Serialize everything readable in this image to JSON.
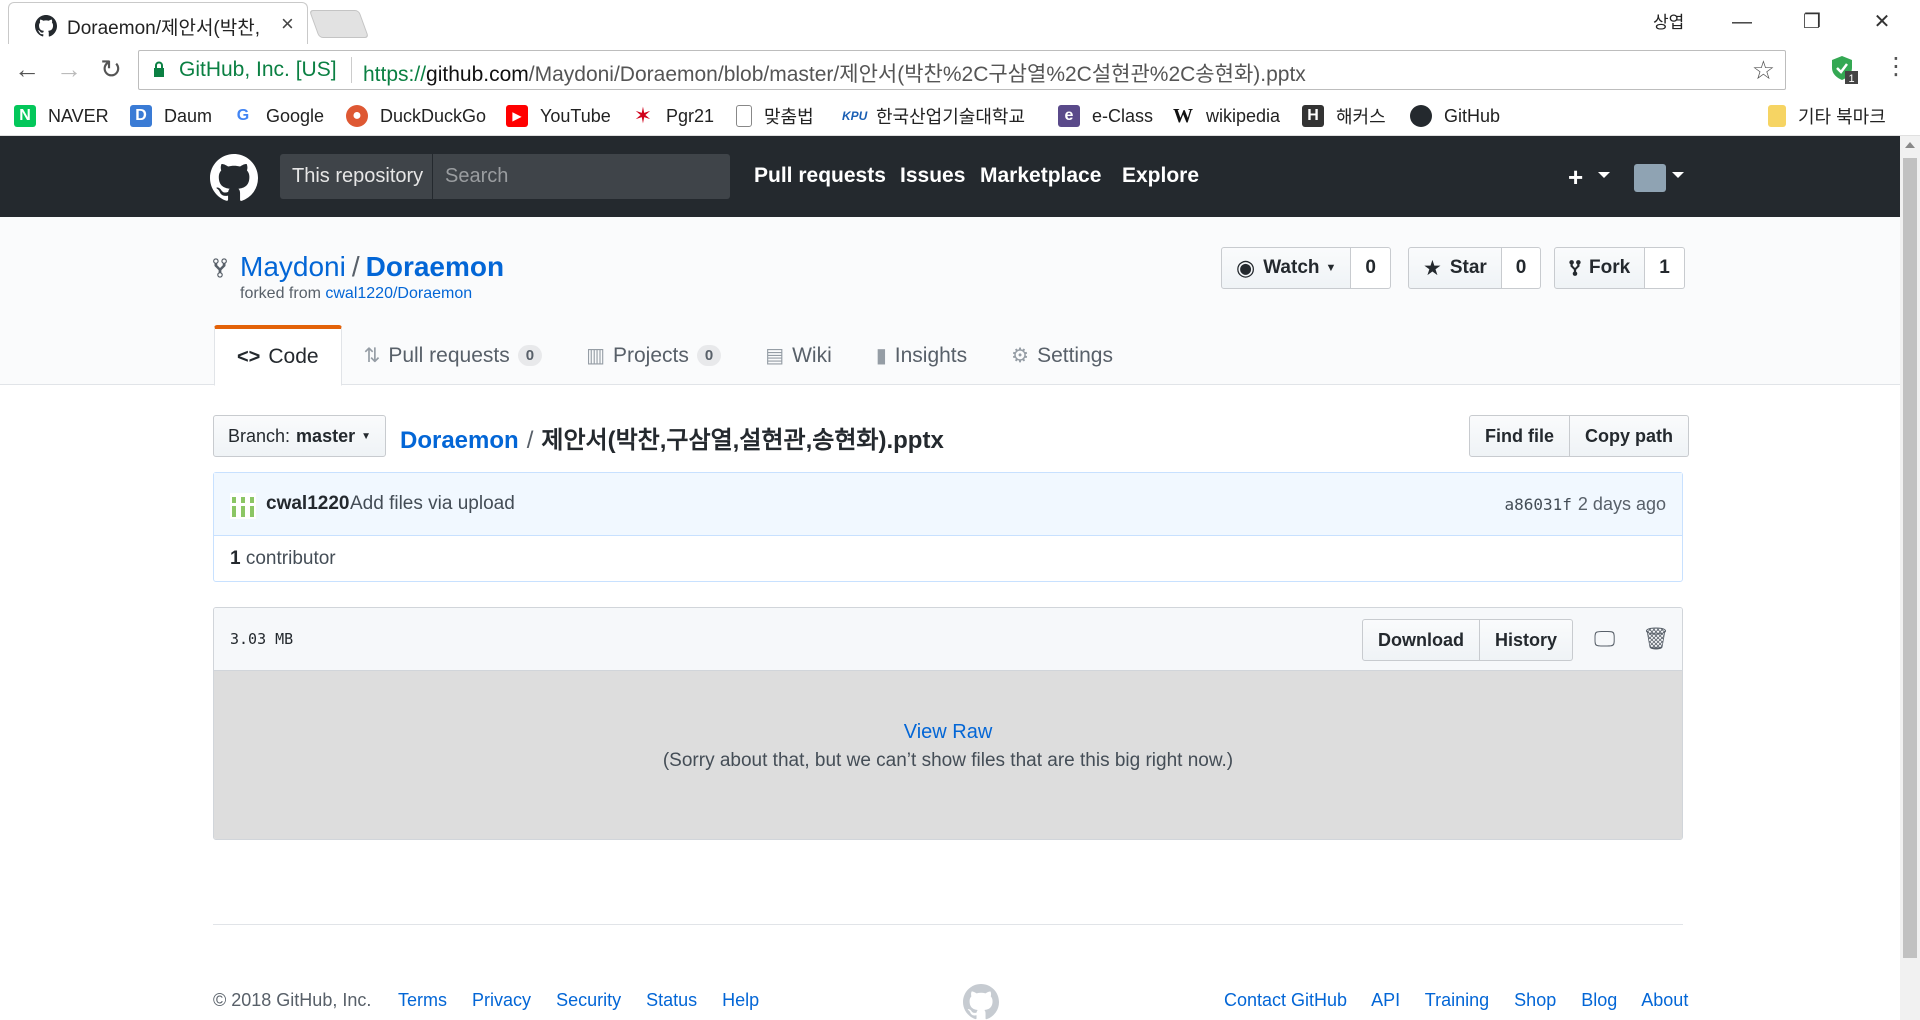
{
  "browser": {
    "tab_title": "Doraemon/제안서(박찬,",
    "profile_name": "상엽",
    "secure_label": "GitHub, Inc. [US]",
    "url_scheme": "https://",
    "url_host": "github.com",
    "url_path": "/Maydoni/Doraemon/blob/master/제안서(박찬%2C구삼열%2C설현관%2C송현화).pptx",
    "extension_badge": "1",
    "bookmarks": [
      {
        "label": "NAVER",
        "icon": "naver-icon",
        "color": "#03c75a",
        "glyph": "N"
      },
      {
        "label": "Daum",
        "icon": "daum-icon",
        "color": "#3a7bd5",
        "glyph": "D"
      },
      {
        "label": "Google",
        "icon": "google-icon",
        "color": "#4285f4",
        "glyph": "G"
      },
      {
        "label": "DuckDuckGo",
        "icon": "duckduckgo-icon",
        "color": "#de5833",
        "glyph": "●"
      },
      {
        "label": "YouTube",
        "icon": "youtube-icon",
        "color": "#ff0000",
        "glyph": "▶"
      },
      {
        "label": "Pgr21",
        "icon": "pgr21-icon",
        "color": "#d0021b",
        "glyph": "✶"
      },
      {
        "label": "맞춤법",
        "icon": "page-icon",
        "color": "#ffffff",
        "glyph": "▯"
      },
      {
        "label": "한국산업기술대학교",
        "icon": "kpu-icon",
        "color": "#1a5fb4",
        "glyph": "K"
      },
      {
        "label": "e-Class",
        "icon": "eclass-icon",
        "color": "#5a4a8a",
        "glyph": "e"
      },
      {
        "label": "wikipedia",
        "icon": "wikipedia-icon",
        "color": "#ffffff",
        "glyph": "W"
      },
      {
        "label": "해커스",
        "icon": "hackers-icon",
        "color": "#333333",
        "glyph": "H"
      },
      {
        "label": "GitHub",
        "icon": "github-icon",
        "color": "#24292e",
        "glyph": "◉"
      }
    ],
    "other_bookmarks": "기타 북마크"
  },
  "gh_header": {
    "scope": "This repository",
    "search_placeholder": "Search",
    "nav": [
      "Pull requests",
      "Issues",
      "Marketplace",
      "Explore"
    ]
  },
  "repo": {
    "owner": "Maydoni",
    "name": "Doraemon",
    "forked_from_label": "forked from",
    "forked_from": "cwal1220/Doraemon",
    "watch_label": "Watch",
    "watch_count": "0",
    "star_label": "Star",
    "star_count": "0",
    "fork_label": "Fork",
    "fork_count": "1",
    "tabs": [
      {
        "label": "Code",
        "icon": "code-icon"
      },
      {
        "label": "Pull requests",
        "count": "0",
        "icon": "pull-request-icon"
      },
      {
        "label": "Projects",
        "count": "0",
        "icon": "project-icon"
      },
      {
        "label": "Wiki",
        "icon": "book-icon"
      },
      {
        "label": "Insights",
        "icon": "graph-icon"
      },
      {
        "label": "Settings",
        "icon": "gear-icon"
      }
    ]
  },
  "file": {
    "branch_label": "Branch:",
    "branch": "master",
    "repo_crumb": "Doraemon",
    "filename": "제안서(박찬,구삼열,설현관,송현화).pptx",
    "find_file": "Find file",
    "copy_path": "Copy path",
    "commit_user": "cwal1220",
    "commit_msg": "Add files via upload",
    "commit_sha": "a86031f",
    "commit_time": "2 days ago",
    "contributor_count": "1",
    "contributor_label": "contributor",
    "size": "3.03 MB",
    "download": "Download",
    "history": "History",
    "view_raw": "View Raw",
    "too_big": "(Sorry about that, but we can’t show files that are this big right now.)"
  },
  "footer": {
    "copyright": "© 2018 GitHub, Inc.",
    "left_links": [
      "Terms",
      "Privacy",
      "Security",
      "Status",
      "Help"
    ],
    "right_links": [
      "Contact GitHub",
      "API",
      "Training",
      "Shop",
      "Blog",
      "About"
    ]
  }
}
